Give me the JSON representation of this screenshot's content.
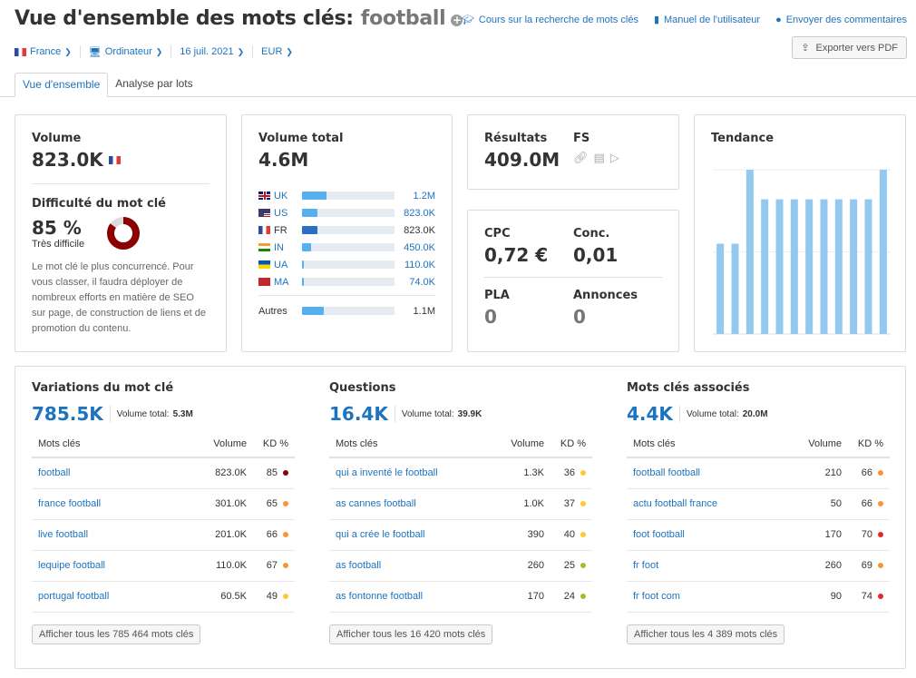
{
  "header": {
    "title": "Vue d'ensemble des mots clés:",
    "keyword": "football",
    "links": [
      {
        "icon": "graduation-cap-icon",
        "label": "Cours sur la recherche de mots clés"
      },
      {
        "icon": "book-icon",
        "label": "Manuel de l'utilisateur"
      },
      {
        "icon": "speech-bubble-icon",
        "label": "Envoyer des commentaires"
      }
    ],
    "export_label": "Exporter vers PDF"
  },
  "filters": {
    "country": "France",
    "device": "Ordinateur",
    "date": "16 juil. 2021",
    "currency": "EUR"
  },
  "tabs": [
    {
      "label": "Vue d'ensemble",
      "active": true
    },
    {
      "label": "Analyse par lots",
      "active": false
    }
  ],
  "volume_card": {
    "label": "Volume",
    "value": "823.0K",
    "kd_label": "Difficulté du mot clé",
    "kd_value": "85 %",
    "kd_percent": 85,
    "kd_text": "Très difficile",
    "kd_color": "#8b0000",
    "description": "Le mot clé le plus concurrencé. Pour vous classer, il faudra déployer de nombreux efforts en matière de SEO sur page, de construction de liens et de promotion du contenu."
  },
  "total_volume_card": {
    "label": "Volume total",
    "value": "4.6M",
    "countries": [
      {
        "code": "UK",
        "value": "1.2M",
        "share": 0.26,
        "link": true
      },
      {
        "code": "US",
        "value": "823.0K",
        "share": 0.17,
        "link": true
      },
      {
        "code": "FR",
        "value": "823.0K",
        "share": 0.17,
        "link": false,
        "current": true
      },
      {
        "code": "IN",
        "value": "450.0K",
        "share": 0.1,
        "link": true
      },
      {
        "code": "UA",
        "value": "110.0K",
        "share": 0.02,
        "link": true
      },
      {
        "code": "MA",
        "value": "74.0K",
        "share": 0.02,
        "link": true
      }
    ],
    "others": {
      "label": "Autres",
      "value": "1.1M",
      "share": 0.24
    }
  },
  "results_card": {
    "results_label": "Résultats",
    "results_value": "409.0M",
    "fs_label": "FS",
    "fs_icons": [
      "link-icon",
      "article-icon",
      "video-play-icon"
    ]
  },
  "cpc_card": {
    "cpc_label": "CPC",
    "cpc_value": "0,72 €",
    "conc_label": "Conc.",
    "conc_value": "0,01",
    "pla_label": "PLA",
    "pla_value": "0",
    "ads_label": "Annonces",
    "ads_value": "0"
  },
  "trend_card": {
    "label": "Tendance"
  },
  "chart_data": {
    "type": "bar",
    "title": "Tendance",
    "categories": [
      "1",
      "2",
      "3",
      "4",
      "5",
      "6",
      "7",
      "8",
      "9",
      "10",
      "11",
      "12"
    ],
    "values": [
      0.55,
      0.55,
      1.0,
      0.82,
      0.82,
      0.82,
      0.82,
      0.82,
      0.82,
      0.82,
      0.82,
      1.0
    ],
    "ylim": [
      0,
      1
    ],
    "grid": true,
    "color": "#93c8ef"
  },
  "sections": [
    {
      "title": "Variations du mot clé",
      "count": "785.5K",
      "total_label": "Volume total:",
      "total_value": "5.3M",
      "columns": [
        "Mots clés",
        "Volume",
        "KD %"
      ],
      "rows": [
        {
          "keyword": "football",
          "volume": "823.0K",
          "kd": "85",
          "kd_color": "#8b0000"
        },
        {
          "keyword": "france football",
          "volume": "301.0K",
          "kd": "65",
          "kd_color": "#f79533"
        },
        {
          "keyword": "live football",
          "volume": "201.0K",
          "kd": "66",
          "kd_color": "#f79533"
        },
        {
          "keyword": "lequipe football",
          "volume": "110.0K",
          "kd": "67",
          "kd_color": "#f79533"
        },
        {
          "keyword": "portugal football",
          "volume": "60.5K",
          "kd": "49",
          "kd_color": "#fdc937"
        }
      ],
      "button": "Afficher tous les 785 464 mots clés"
    },
    {
      "title": "Questions",
      "count": "16.4K",
      "total_label": "Volume total:",
      "total_value": "39.9K",
      "columns": [
        "Mots clés",
        "Volume",
        "KD %"
      ],
      "rows": [
        {
          "keyword": "qui a inventé le football",
          "volume": "1.3K",
          "kd": "36",
          "kd_color": "#fdc937"
        },
        {
          "keyword": "as cannes football",
          "volume": "1.0K",
          "kd": "37",
          "kd_color": "#fdc937"
        },
        {
          "keyword": "qui a crée le football",
          "volume": "390",
          "kd": "40",
          "kd_color": "#fdc937"
        },
        {
          "keyword": "as football",
          "volume": "260",
          "kd": "25",
          "kd_color": "#9cbf2b"
        },
        {
          "keyword": "as fontonne football",
          "volume": "170",
          "kd": "24",
          "kd_color": "#9cbf2b"
        }
      ],
      "button": "Afficher tous les 16 420 mots clés"
    },
    {
      "title": "Mots clés associés",
      "count": "4.4K",
      "total_label": "Volume total:",
      "total_value": "20.0M",
      "columns": [
        "Mots clés",
        "Volume",
        "KD %"
      ],
      "rows": [
        {
          "keyword": "football football",
          "volume": "210",
          "kd": "66",
          "kd_color": "#f79533"
        },
        {
          "keyword": "actu football france",
          "volume": "50",
          "kd": "66",
          "kd_color": "#f79533"
        },
        {
          "keyword": "foot football",
          "volume": "170",
          "kd": "70",
          "kd_color": "#e8262a"
        },
        {
          "keyword": "fr foot",
          "volume": "260",
          "kd": "69",
          "kd_color": "#f79533"
        },
        {
          "keyword": "fr foot com",
          "volume": "90",
          "kd": "74",
          "kd_color": "#e8262a"
        }
      ],
      "button": "Afficher tous les 4 389 mots clés"
    }
  ]
}
